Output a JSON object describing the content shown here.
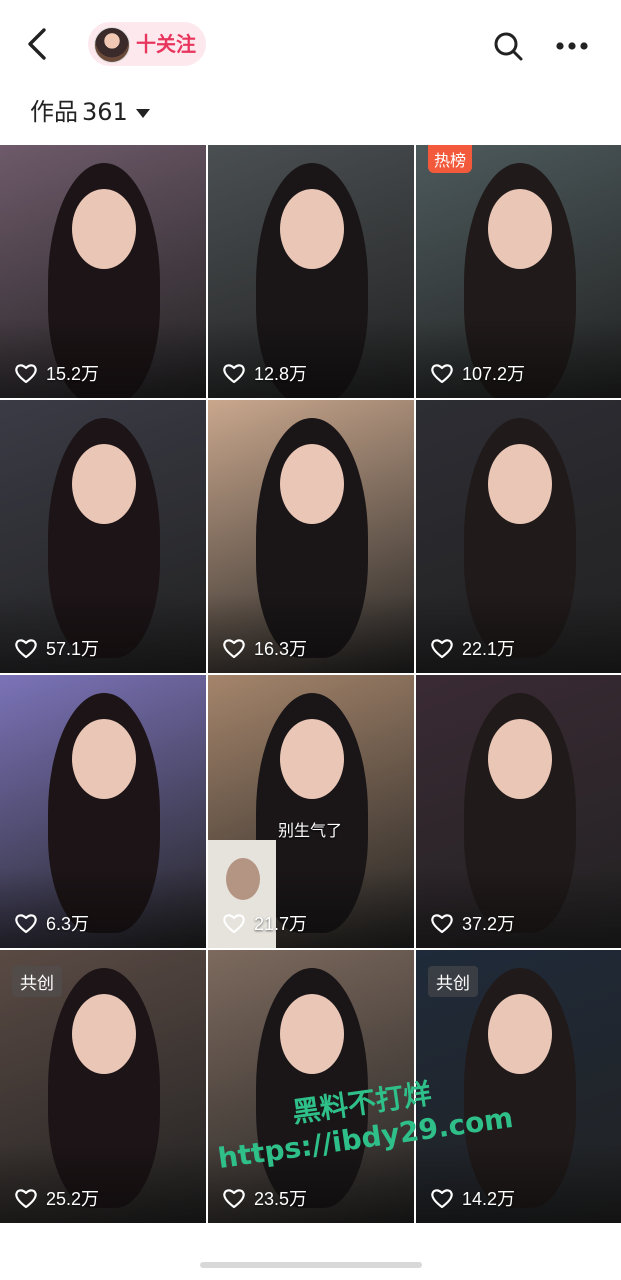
{
  "header": {
    "follow_label": "十关注",
    "colors": {
      "follow_text": "#e8355d",
      "follow_bg": "#fde8ee"
    }
  },
  "works": {
    "label": "作品",
    "count": "361"
  },
  "videos": [
    {
      "likes": "15.2万",
      "badge": "",
      "bg": "#6e5a6a"
    },
    {
      "likes": "12.8万",
      "badge": "",
      "bg": "#4a4f52"
    },
    {
      "likes": "107.2万",
      "badge": "热榜",
      "bg": "#4d5a5c"
    },
    {
      "likes": "57.1万",
      "badge": "",
      "bg": "#3a3b45"
    },
    {
      "likes": "16.3万",
      "badge": "",
      "bg": "#c9a78d"
    },
    {
      "likes": "22.1万",
      "badge": "",
      "bg": "#2d2d34"
    },
    {
      "likes": "6.3万",
      "badge": "",
      "bg": "#7b73b8"
    },
    {
      "likes": "21.7万",
      "badge": "",
      "bg": "#a5856b",
      "overlay_text": "别生气了"
    },
    {
      "likes": "37.2万",
      "badge": "",
      "bg": "#3a2a34"
    },
    {
      "likes": "25.2万",
      "badge": "共创",
      "bg": "#5a4a44"
    },
    {
      "likes": "23.5万",
      "badge": "",
      "bg": "#7d6a5e"
    },
    {
      "likes": "14.2万",
      "badge": "共创",
      "bg": "#1f2a3a"
    }
  ],
  "watermark": {
    "line1": "黑料不打烊",
    "line2": "https://ibdy29.com"
  }
}
